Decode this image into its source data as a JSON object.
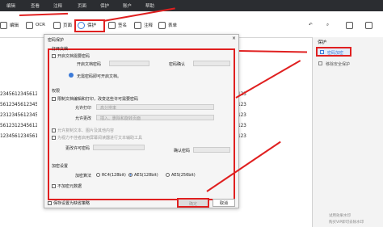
{
  "menubar": {
    "items": [
      "编辑",
      "查看",
      "注释",
      "页面",
      "保护",
      "账户",
      "帮助"
    ]
  },
  "toolbar": {
    "edit_label": "编辑",
    "ocr_label": "OCR",
    "page_label": "页面",
    "protect_label": "保护",
    "sign_label": "签名",
    "comment_label": "注释",
    "form_label": "表单"
  },
  "document": {
    "lines": [
      "2345612345612",
      "5612345612345",
      "2312345612345",
      "5612312345612",
      "1234561234561"
    ],
    "right_digits": [
      "123",
      "123",
      "123",
      "123",
      "123"
    ]
  },
  "right_panel": {
    "section_title": "保护",
    "password_item": "密码加密",
    "remove_item": "移除安全保护",
    "bottom_text_1": "试用效果水印",
    "bottom_text_2": "购买VIP即可去除水印"
  },
  "dialog": {
    "title": "密码保护",
    "open_section": "打开文档",
    "open_checkbox": "开启文档需要密码",
    "open_password_label": "开启文档密码",
    "open_confirm_label": "密码确认",
    "open_hint": "无需密码即可开启文档。",
    "permission_section": "权限",
    "permission_checkbox": "限制文档编辑和打印，改变这些许可需要密码",
    "print_label": "允许打印",
    "print_value": "高分辨率",
    "change_label": "允许更改",
    "change_value": "插入、删除和旋转页面",
    "copy_option": "允许复制文本、图片及其他内容",
    "reader_option": "为视力不佳者启用屏幕阅读器进行文本辅助工具",
    "change_password_label": "更改许可密码",
    "change_confirm_label": "确认密码",
    "encrypt_section": "加密设置",
    "encrypt_label": "加密算法",
    "rc4": "RC4(128bit)",
    "aes128": "AES(128bit)",
    "aes256": "AES(256bit)",
    "no_encrypt": "不加密元数据",
    "save_checkbox": "保存设置为缺省策略",
    "ok_button": "确定",
    "cancel_button": "取消"
  },
  "colors": {
    "annotation_red": "#e02020",
    "menubar_bg": "#2b2d31",
    "accent_blue": "#3b7ad8"
  }
}
